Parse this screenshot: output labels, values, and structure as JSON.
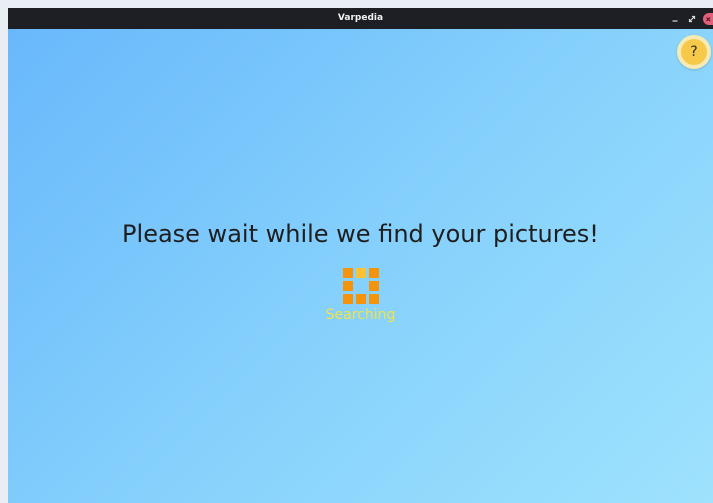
{
  "window": {
    "title": "Varpedia"
  },
  "help_button": {
    "label": "?"
  },
  "loading": {
    "message": "Please wait while we find your pictures!",
    "status": "Searching",
    "spinner_icon": "loading-spinner-icon"
  },
  "colors": {
    "title_bar": "#1d1f24",
    "background_start": "#69b8fb",
    "background_end": "#9ee2fd",
    "spinner": "#f4940d",
    "spinner_highlight": "#fbc236",
    "status_text": "#f3e246",
    "help_button": "#f6c94a",
    "close_button": "#e45f7b"
  }
}
